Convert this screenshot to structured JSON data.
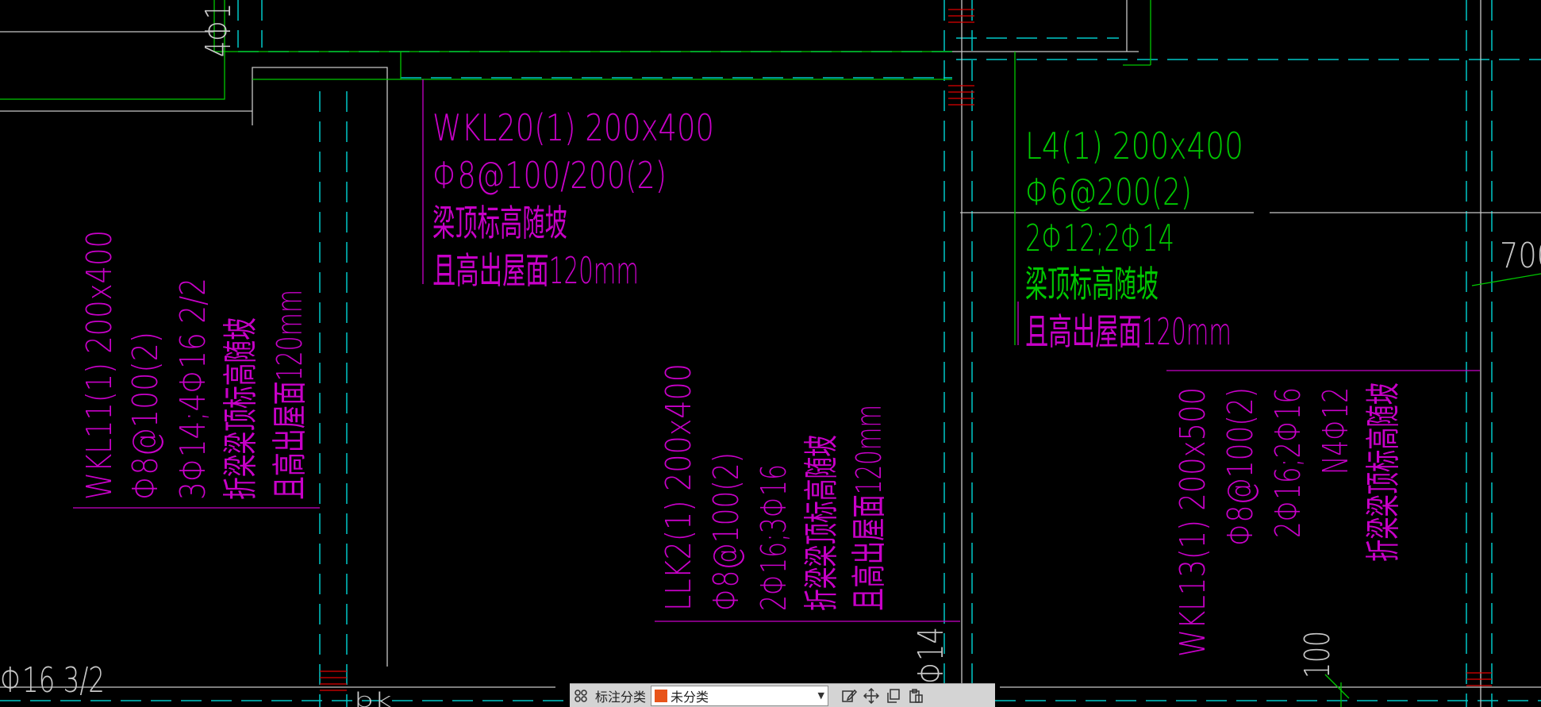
{
  "annotations": {
    "wkl20": [
      "WKL20(1) 200x400",
      "Φ8@100/200(2)",
      "梁顶标高随坡",
      "且高出屋面120mm"
    ],
    "l4": [
      "L4(1) 200x400",
      "Φ6@200(2)",
      "2Φ12;2Φ14",
      "梁顶标高随坡",
      "且高出屋面120mm"
    ],
    "wkl11": [
      "WKL11(1) 200x400",
      "Φ8@100(2)",
      "3Φ14;4Φ16 2/2",
      "折梁梁顶标高随坡",
      "且高出屋面120mm"
    ],
    "llk2": [
      "LLK2(1) 200x400",
      "Φ8@100(2)",
      "2Φ16;3Φ16",
      "折梁梁顶标高随坡",
      "且高出屋面120mm"
    ],
    "wkl13": [
      "WKL13(1) 200x500",
      "Φ8@100(2)",
      "2Φ16;2Φ16",
      "N4Φ12",
      "折梁梁顶标高随坡"
    ],
    "misc": {
      "top_left": "4Φ1",
      "bottom_left": "Φ16 3/2",
      "right_edge": "700",
      "phi14": "Φ14",
      "dim100": "100",
      "bottom_fragment": "bk"
    }
  },
  "toolbar": {
    "grid_icon": "grid-icon",
    "category_label": "标注分类",
    "category_value": "未分类",
    "category_color": "#e8541a",
    "tools": [
      "edit-icon",
      "move-icon",
      "copy-icon",
      "paste-icon"
    ]
  },
  "colors": {
    "background": "#000000",
    "cyan": "#00c8c8",
    "green": "#00c800",
    "magenta": "#c800c8",
    "white": "#c8c8c8",
    "red": "#e00000"
  }
}
